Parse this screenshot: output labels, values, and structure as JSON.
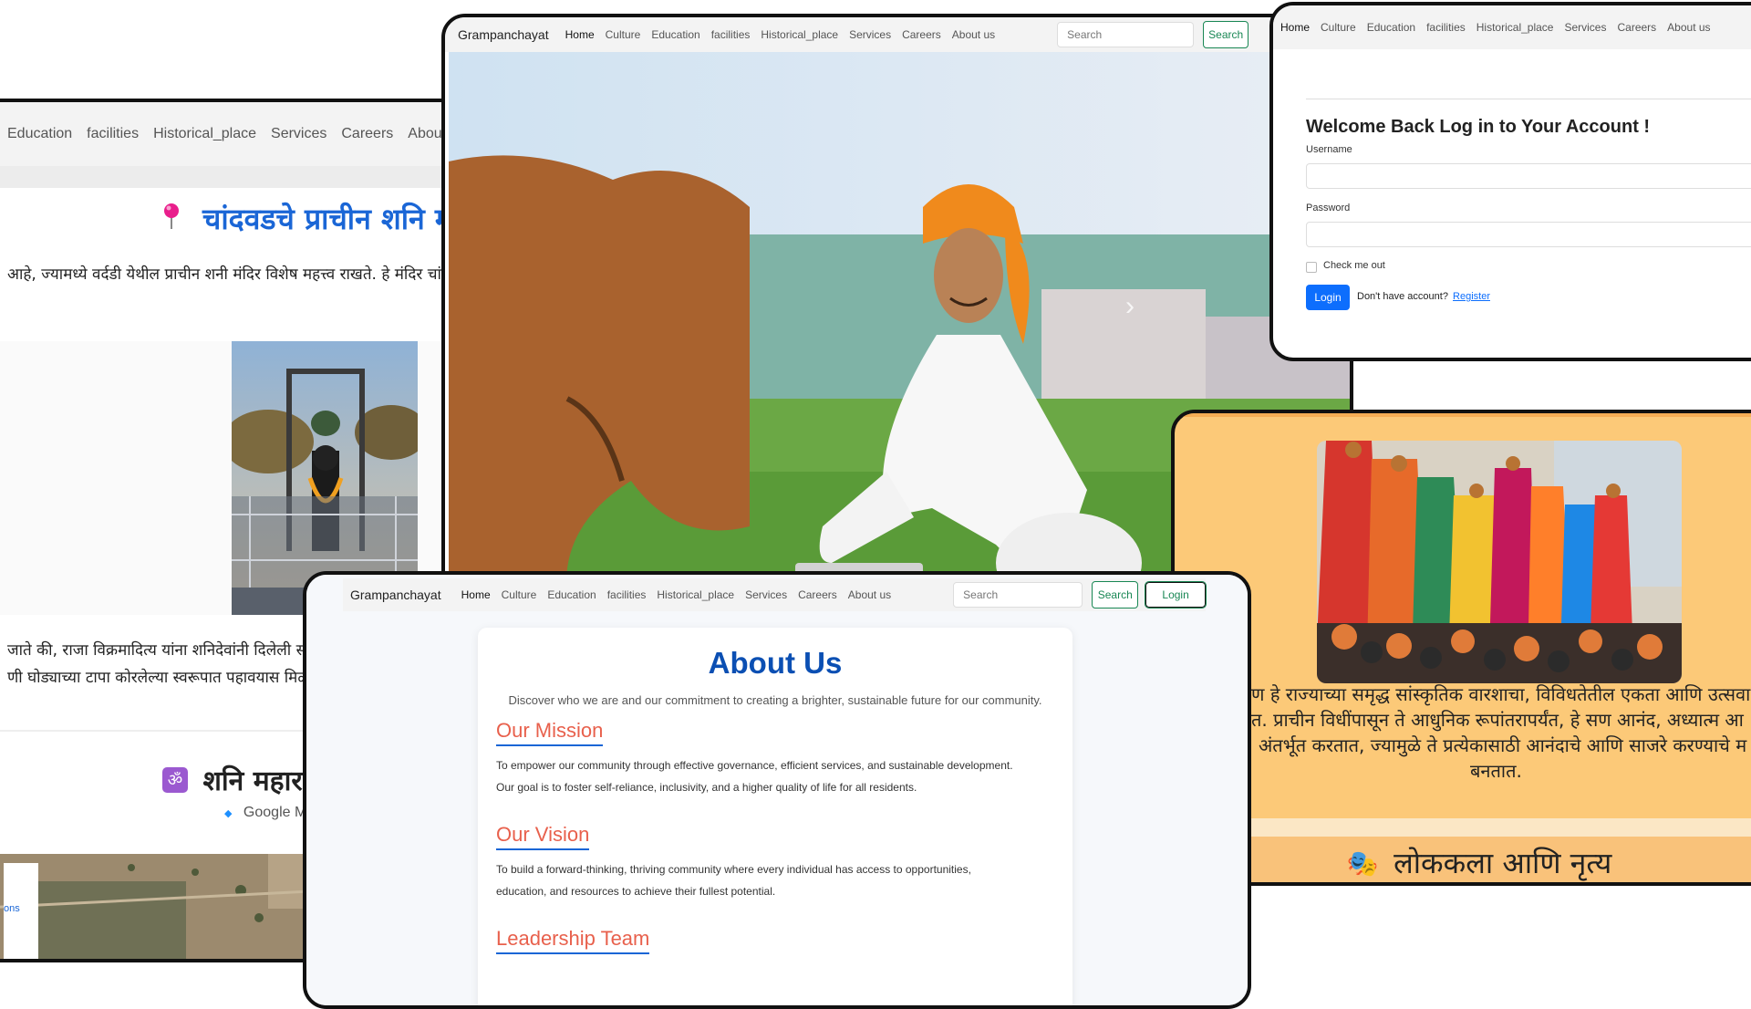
{
  "nav": {
    "brand": "Grampanchayat",
    "links": [
      "Home",
      "Culture",
      "Education",
      "facilities",
      "Historical_place",
      "Services",
      "Careers",
      "About us"
    ],
    "search_placeholder": "Search",
    "search_button": "Search",
    "login_button": "Login"
  },
  "temple": {
    "title": "चांदवडचे प्राचीन शनि मंदिर",
    "intro": "आहे, ज्यामध्ये वर्दडी येथील प्राचीन शनी मंदिर विशेष महत्त्व राखते. हे मंदिर चांदवड गावाहून साधारणतः दहा किलोमीटर ईशा",
    "story_line1": "जाते की, राजा विक्रमादित्य यांना शनिदेवांनी दिलेली सा",
    "story_line2": "णी घोड्याच्या टापा कोरलेल्या स्वरूपात पहावयास मिळ",
    "section2_title": "शनि महार",
    "maps_label": "Google M",
    "map_overlay": "ons"
  },
  "login": {
    "heading": "Welcome Back Log in to Your Account !",
    "username_label": "Username",
    "password_label": "Password",
    "remember_label": "Check me out",
    "login_button": "Login",
    "no_account": "Don't have account?",
    "register_link": "Register"
  },
  "culture": {
    "para_line1": "ण हे राज्याच्या समृद्ध सांस्कृतिक वारशाचा, विविधतेतील एकता आणि उत्सवा",
    "para_line2": "त. प्राचीन विधींपासून ते आधुनिक रूपांतरापर्यंत, हे सण आनंद, अध्यात्म आ",
    "para_line3": "अंतर्भूत करतात, ज्यामुळे ते प्रत्येकासाठी आनंदाचे आणि साजरे करण्याचे म",
    "para_line4": "बनतात.",
    "folk_title": "लोककला आणि नृत्य"
  },
  "about": {
    "title": "About Us",
    "subtitle": "Discover who we are and our commitment to creating a brighter, sustainable future for our community.",
    "mission_heading": "Our Mission",
    "mission_line1": "To empower our community through effective governance, efficient services, and sustainable development.",
    "mission_line2": "Our goal is to foster self-reliance, inclusivity, and a higher quality of life for all residents.",
    "vision_heading": "Our Vision",
    "vision_line1": "To build a forward-thinking, thriving community where every individual has access to opportunities,",
    "vision_line2": "education, and resources to achieve their fullest potential.",
    "leadership_heading": "Leadership Team"
  },
  "icons": {
    "pin": "map-pin-icon",
    "om": "om-icon",
    "masks": "theatre-masks-icon",
    "next": "chevron-right-icon"
  },
  "colors": {
    "primary": "#0d6efd",
    "success": "#198754",
    "title_blue": "#0b4fb3",
    "coral": "#e8604c",
    "culture_bg": "#fcc978",
    "folk_bar": "#f9c27a",
    "pin": "#e91e8c"
  }
}
